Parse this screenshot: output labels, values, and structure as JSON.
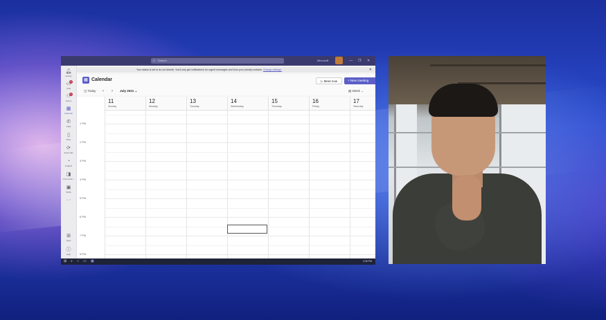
{
  "teams": {
    "search_placeholder": "Search",
    "user_name": "Microsoft",
    "window_controls": [
      "—",
      "❐",
      "✕"
    ],
    "rail": [
      {
        "icon": "bell-icon",
        "label": "Activity"
      },
      {
        "icon": "chat-icon",
        "label": "Chat",
        "badge": "2"
      },
      {
        "icon": "teams-icon",
        "label": "Teams",
        "badge": "1"
      },
      {
        "icon": "calendar-icon",
        "label": "Calendar",
        "active": true
      },
      {
        "icon": "phone-icon",
        "label": "Calls"
      },
      {
        "icon": "files-icon",
        "label": "Files"
      },
      {
        "icon": "approvals-icon",
        "label": "Approvals"
      },
      {
        "icon": "insights-icon",
        "label": "Insights"
      },
      {
        "icon": "communities-icon",
        "label": "Communiti..."
      },
      {
        "icon": "shifts-icon",
        "label": "Shifts"
      },
      {
        "icon": "apps-icon",
        "label": "Apps"
      },
      {
        "icon": "help-icon",
        "label": "Help"
      }
    ],
    "notice": {
      "text": "Your status is set to do not disturb. You'll only get notifications for urgent messages and from your priority contacts.",
      "link": "Change settings."
    },
    "calendar": {
      "title": "Calendar",
      "meet_now": "Meet now",
      "new_meeting": "New meeting",
      "today": "Today",
      "month": "July 2021",
      "view": "Week",
      "days": [
        {
          "num": "11",
          "name": "Sunday"
        },
        {
          "num": "12",
          "name": "Monday"
        },
        {
          "num": "13",
          "name": "Tuesday"
        },
        {
          "num": "14",
          "name": "Wednesday"
        },
        {
          "num": "15",
          "name": "Thursday"
        },
        {
          "num": "16",
          "name": "Friday"
        },
        {
          "num": "17",
          "name": "Saturday"
        }
      ],
      "times": [
        "1 PM",
        "2 PM",
        "3 PM",
        "4 PM",
        "5 PM",
        "6 PM",
        "7 PM",
        "8 PM"
      ]
    }
  },
  "taskbar": {
    "clock": "4:36 PM"
  }
}
